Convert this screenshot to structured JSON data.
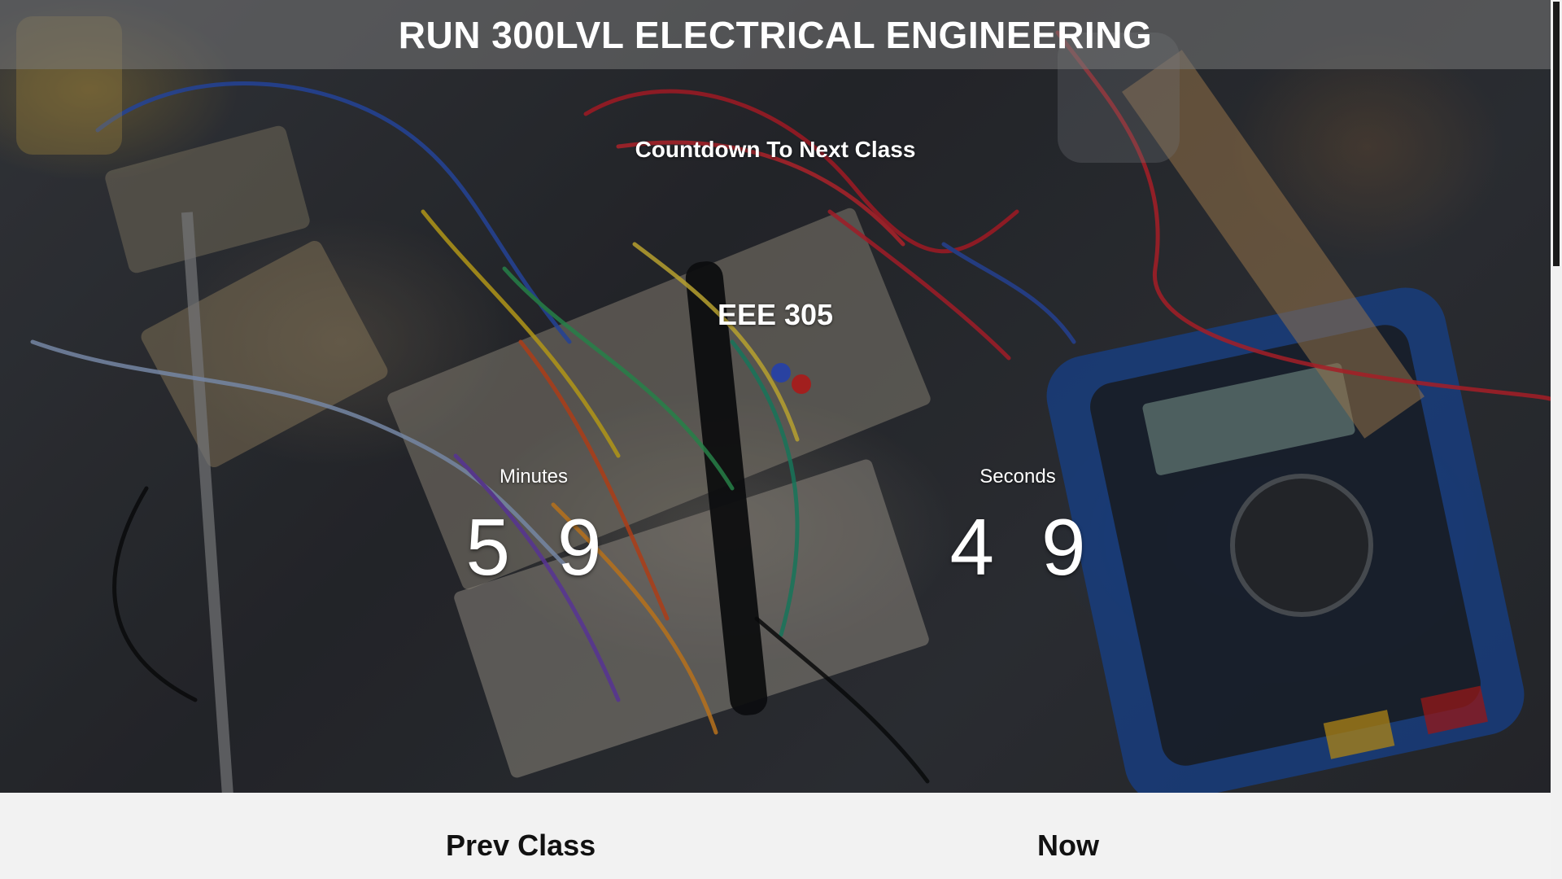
{
  "header": {
    "title": "RUN 300LVL ELECTRICAL ENGINEERING"
  },
  "countdown": {
    "heading": "Countdown To Next Class",
    "course": "EEE 305",
    "minutes": {
      "label": "Minutes",
      "digits": [
        "5",
        "9"
      ]
    },
    "seconds": {
      "label": "Seconds",
      "digits": [
        "4",
        "9"
      ]
    }
  },
  "schedule": {
    "prev_label": "Prev Class",
    "now_label": "Now"
  },
  "colors": {
    "title_bar": "#787878",
    "text_light": "#ffffff",
    "bottom_bg": "#f2f2f2",
    "bottom_text": "#111111"
  }
}
